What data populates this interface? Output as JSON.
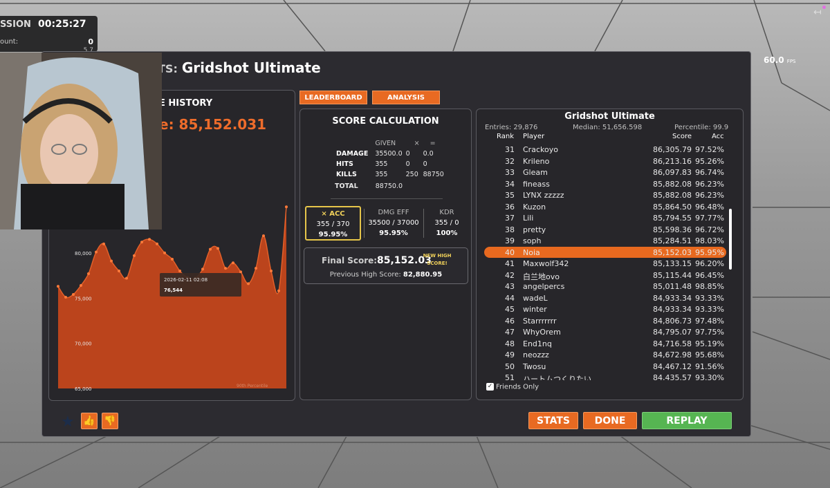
{
  "session": {
    "label": "SSION",
    "time": "00:25:27",
    "count_label": "ount:",
    "count_value": "0",
    "sub_value": "5.7"
  },
  "fps": {
    "value": "60.0",
    "unit": "FPS"
  },
  "title": {
    "prefix": "TS:",
    "name": "Gridshot Ultimate"
  },
  "history": {
    "title": "E HISTORY",
    "score_label": "e: 85,152.031",
    "tooltip_date": "2026-02-11 02:08",
    "tooltip_value": "76,544",
    "percentile_label": "90th Percentile"
  },
  "chart_data": {
    "type": "area",
    "title": "",
    "xlabel": "",
    "ylabel": "",
    "ylim": [
      65000,
      85500
    ],
    "yticks": [
      65000,
      70000,
      75000,
      80000
    ],
    "y_tick_labels": [
      "65,000",
      "70,000",
      "75,000",
      "80,000"
    ],
    "x": [
      0,
      1,
      2,
      3,
      4,
      5,
      6,
      7,
      8,
      9,
      10,
      11,
      12,
      13,
      14,
      15,
      16,
      17,
      18,
      19,
      20,
      21,
      22,
      23,
      24,
      25,
      26,
      27,
      28,
      29,
      30
    ],
    "values": [
      76300,
      75100,
      75400,
      76400,
      77700,
      80100,
      81000,
      79100,
      78000,
      77200,
      79700,
      81200,
      81500,
      81000,
      80000,
      79300,
      78000,
      77300,
      77200,
      78200,
      80400,
      80500,
      78300,
      78900,
      77900,
      76600,
      78300,
      81900,
      78000,
      75800,
      85100
    ],
    "color": "#c8461b"
  },
  "tabs": [
    {
      "label": "LEADERBOARD"
    },
    {
      "label": "ANALYSIS"
    }
  ],
  "calc": {
    "title": "SCORE CALCULATION",
    "headers": {
      "given": "GIVEN",
      "mult": "×",
      "eq": "="
    },
    "rows": [
      {
        "name": "DAMAGE",
        "given": "35500.0",
        "mult": "0",
        "eq": "0.0"
      },
      {
        "name": "HITS",
        "given": "355",
        "mult": "0",
        "eq": "0"
      },
      {
        "name": "KILLS",
        "given": "355",
        "mult": "250",
        "eq": "88750"
      }
    ],
    "total_label": "TOTAL",
    "total_value": "88750.0",
    "acc": {
      "label": "× ACC",
      "v1": "355 / 370",
      "v2": "95.95%"
    },
    "dmg_eff": {
      "label": "DMG EFF",
      "v1": "35500 / 37000",
      "v2": "95.95%"
    },
    "kdr": {
      "label": "KDR",
      "v1": "355 / 0",
      "v2": "100%"
    },
    "final_label": "Final Score:",
    "final_value": "85,152.03",
    "new_high": "NEW HIGH SCORE!",
    "prev_label": "Previous High Score:",
    "prev_value": "82,880.95"
  },
  "leaderboard": {
    "title": "Gridshot Ultimate",
    "entries": "Entries: 29,876",
    "median": "Median: 51,656.598",
    "percentile": "Percentile: 99.9",
    "col_rank": "Rank",
    "col_player": "Player",
    "col_score": "Score",
    "col_acc": "Acc",
    "rows": [
      {
        "rank": "31",
        "player": "Crackoyo",
        "score": "86,305.79",
        "acc": "97.52%"
      },
      {
        "rank": "32",
        "player": "Krileno",
        "score": "86,213.16",
        "acc": "95.26%"
      },
      {
        "rank": "33",
        "player": "Gleam",
        "score": "86,097.83",
        "acc": "96.74%"
      },
      {
        "rank": "34",
        "player": "fineass",
        "score": "85,882.08",
        "acc": "96.23%"
      },
      {
        "rank": "35",
        "player": "LYNX zzzzz",
        "score": "85,882.08",
        "acc": "96.23%"
      },
      {
        "rank": "36",
        "player": "Kuzon",
        "score": "85,864.50",
        "acc": "96.48%"
      },
      {
        "rank": "37",
        "player": "Lili",
        "score": "85,794.55",
        "acc": "97.77%"
      },
      {
        "rank": "38",
        "player": "pretty",
        "score": "85,598.36",
        "acc": "96.72%"
      },
      {
        "rank": "39",
        "player": "soph",
        "score": "85,284.51",
        "acc": "98.03%"
      },
      {
        "rank": "40",
        "player": "Noia",
        "score": "85,152.03",
        "acc": "95.95%"
      },
      {
        "rank": "41",
        "player": "Maxwolf342",
        "score": "85,133.15",
        "acc": "96.20%"
      },
      {
        "rank": "42",
        "player": "白兰地ovo",
        "score": "85,115.44",
        "acc": "96.45%"
      },
      {
        "rank": "43",
        "player": "angelpercs",
        "score": "85,011.48",
        "acc": "98.85%"
      },
      {
        "rank": "44",
        "player": "wadeL",
        "score": "84,933.34",
        "acc": "93.33%"
      },
      {
        "rank": "45",
        "player": "winter",
        "score": "84,933.34",
        "acc": "93.33%"
      },
      {
        "rank": "46",
        "player": "Starrrrrrr",
        "score": "84,806.73",
        "acc": "97.48%"
      },
      {
        "rank": "47",
        "player": "WhyOrem",
        "score": "84,795.07",
        "acc": "97.75%"
      },
      {
        "rank": "48",
        "player": "End1nq",
        "score": "84,716.58",
        "acc": "95.19%"
      },
      {
        "rank": "49",
        "player": "neozzz",
        "score": "84,672.98",
        "acc": "95.68%"
      },
      {
        "rank": "50",
        "player": "Twosu",
        "score": "84,467.12",
        "acc": "91.56%"
      },
      {
        "rank": "51",
        "player": "ハートムつくりたい",
        "score": "84,435.57",
        "acc": "93.30%"
      }
    ],
    "highlight_rank": "40",
    "friends_label": "Friends Only",
    "friends_checked": true
  },
  "footer": {
    "stats": "STATS",
    "done": "DONE",
    "replay": "REPLAY"
  },
  "icons": {
    "star": "star-icon",
    "thumb_up": "thumbs-up-icon",
    "thumb_down": "thumbs-down-icon",
    "exit": "exit-icon"
  },
  "colors": {
    "accent": "#e86a22",
    "green": "#56b552",
    "highlight": "#f2d25a",
    "panel": "#2c2b30"
  }
}
